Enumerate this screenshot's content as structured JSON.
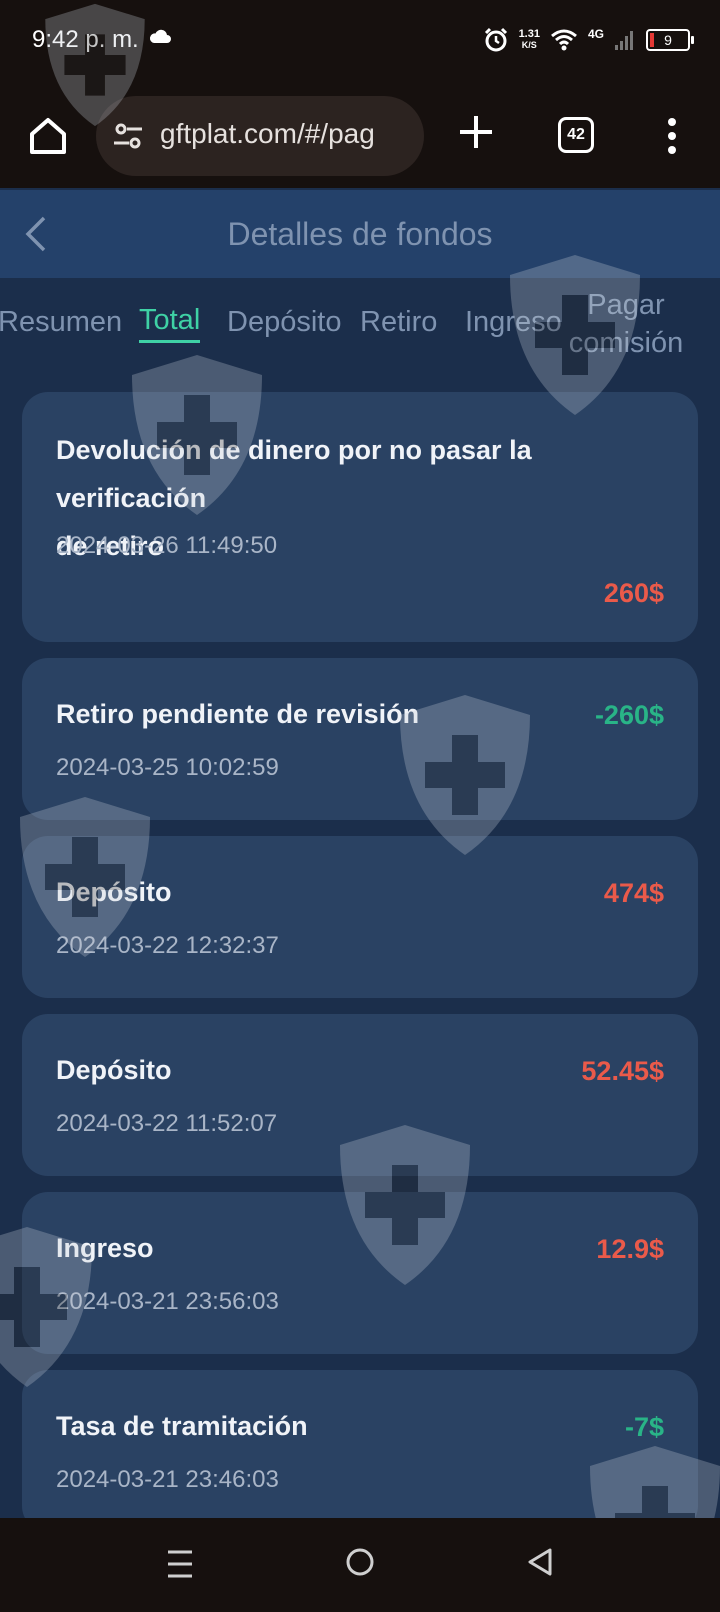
{
  "status_bar": {
    "time": "9:42 p. m.",
    "speed_value": "1.31",
    "speed_unit": "K/S",
    "network": "4G",
    "battery": "9",
    "icons": [
      "cloud-icon",
      "alarm-icon",
      "wifi-icon",
      "signal-icon",
      "battery-icon"
    ]
  },
  "browser": {
    "url": "gftplat.com/#/pag",
    "tab_count": "42",
    "icons": [
      "home-icon",
      "tune-icon",
      "plus-icon",
      "tabs-icon",
      "more-vert-icon"
    ]
  },
  "header": {
    "title": "Detalles de fondos",
    "back_icon": "chevron-left-icon"
  },
  "tabs": [
    {
      "label": "Resumen",
      "active": false
    },
    {
      "label": "Total",
      "active": true
    },
    {
      "label": "Depósito",
      "active": false
    },
    {
      "label": "Retiro",
      "active": false
    },
    {
      "label": "Ingreso",
      "active": false
    },
    {
      "label": "Pagar comisión",
      "active": false
    }
  ],
  "transactions": [
    {
      "title_line1": "Devolución de dinero por no pasar la verificación",
      "title_line2": "de retiro",
      "date": "2024-03-26 11:49:50",
      "amount": "260$",
      "direction": "credit"
    },
    {
      "title_line1": "Retiro pendiente de revisión",
      "date": "2024-03-25 10:02:59",
      "amount": "-260$",
      "direction": "debit"
    },
    {
      "title_line1": "Depósito",
      "date": "2024-03-22 12:32:37",
      "amount": "474$",
      "direction": "credit"
    },
    {
      "title_line1": "Depósito",
      "date": "2024-03-22 11:52:07",
      "amount": "52.45$",
      "direction": "credit"
    },
    {
      "title_line1": "Ingreso",
      "date": "2024-03-21 23:56:03",
      "amount": "12.9$",
      "direction": "credit"
    },
    {
      "title_line1": "Tasa de tramitación",
      "date": "2024-03-21 23:46:03",
      "amount": "-7$",
      "direction": "debit"
    }
  ],
  "colors": {
    "background": "#1b2e4b",
    "card": "#2a4263",
    "header": "#24416a",
    "accent": "#3fd1a5",
    "credit": "#ea5a4a",
    "debit": "#29b487"
  },
  "nav": {
    "icons": [
      "recent-apps-icon",
      "home-circle-icon",
      "back-triangle-icon"
    ]
  },
  "watermark_icon": "shield-cross-icon"
}
